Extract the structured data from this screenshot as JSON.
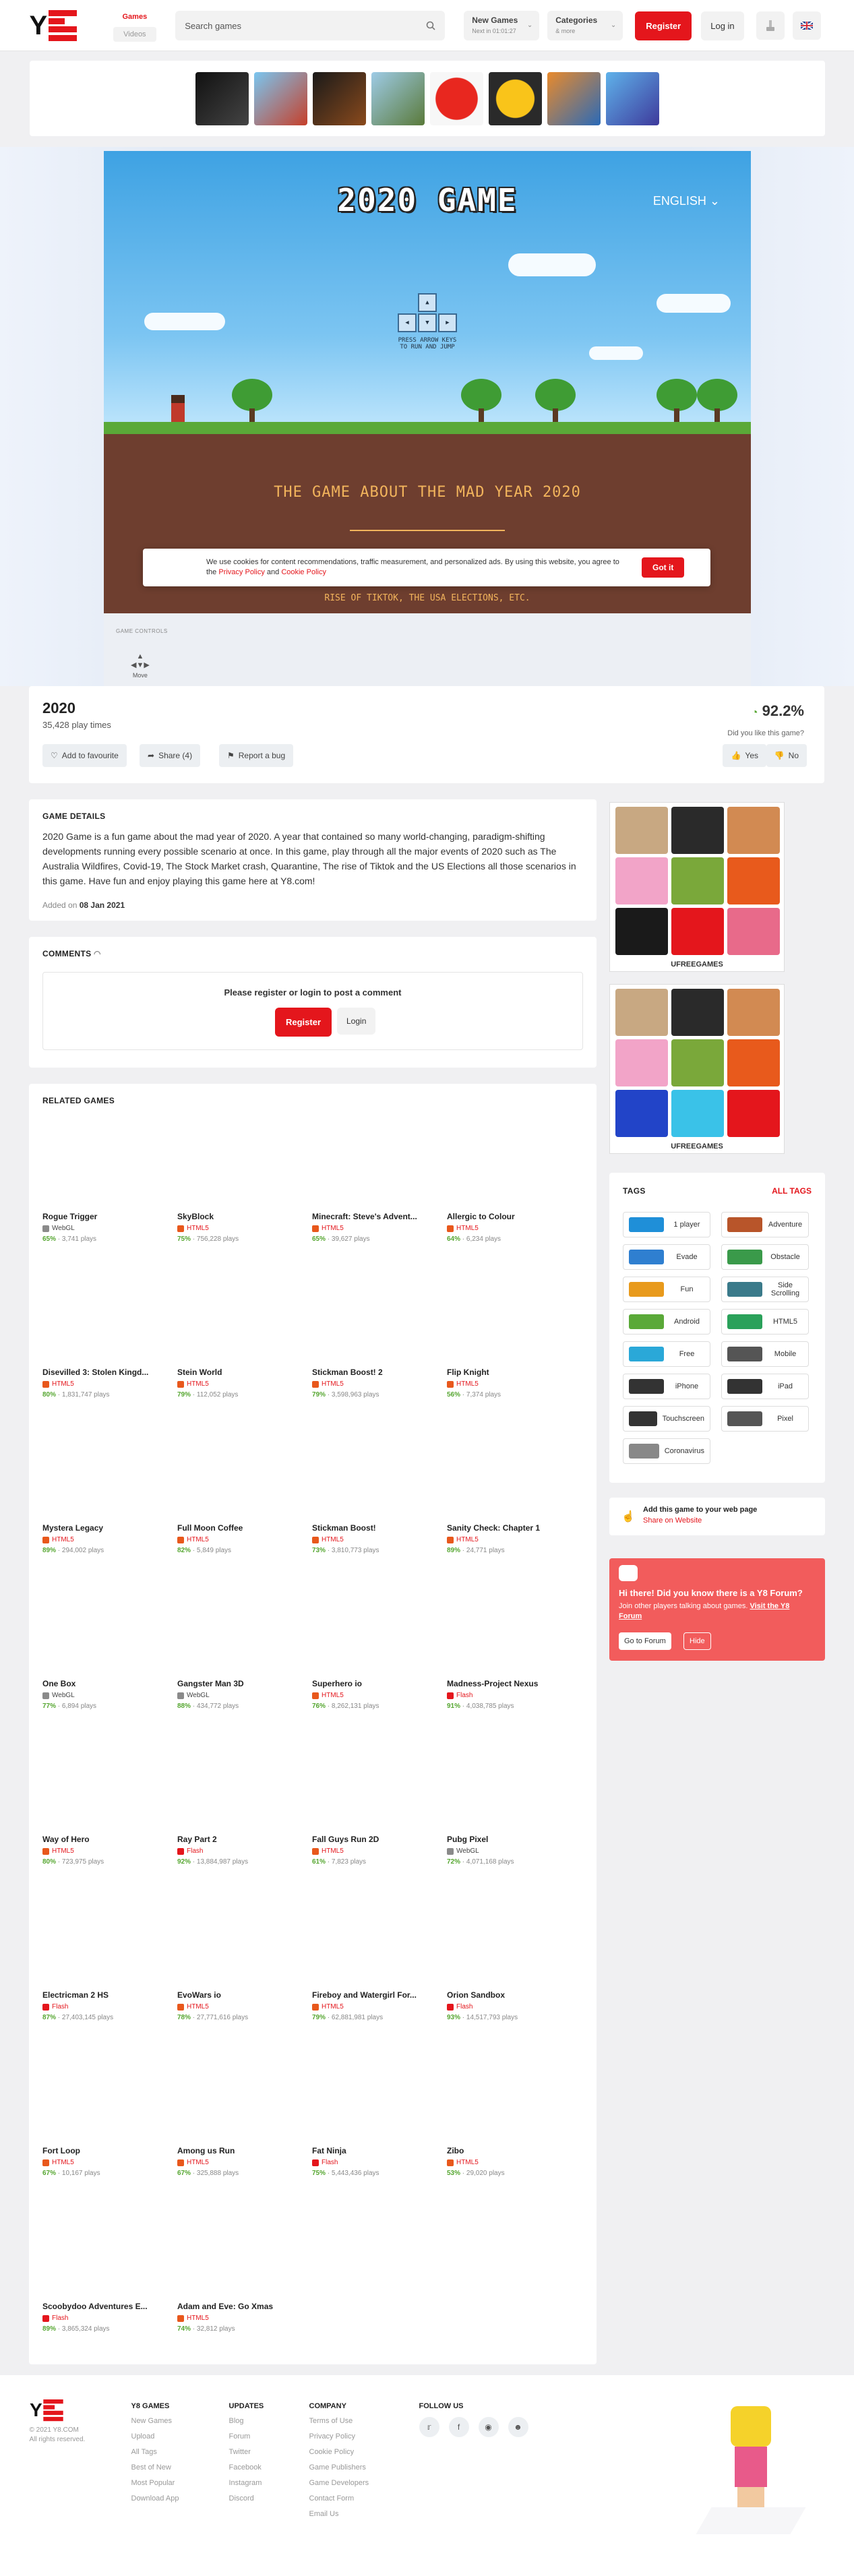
{
  "header": {
    "tabs": [
      "Games",
      "Videos"
    ],
    "search_placeholder": "Search games",
    "new_games": {
      "label": "New Games",
      "sub": "Next in 01:01:27"
    },
    "categories": {
      "label": "Categories",
      "sub": "& more"
    },
    "register": "Register",
    "login": "Log in"
  },
  "game": {
    "title_art": "2020 GAME",
    "language": "ENGLISH",
    "keys_hint": "PRESS ARROW KEYS TO RUN AND JUMP",
    "subtitle": "THE GAME ABOUT THE MAD YEAR 2020",
    "rise_text": "RISE OF TIKTOK, THE USA ELECTIONS, ETC.",
    "controls_label": "GAME CONTROLS",
    "controls_move": "Move"
  },
  "cookie": {
    "text": "We use cookies for content recommendations, traffic measurement, and personalized ads. By using this website, you agree to the",
    "privacy": "Privacy Policy",
    "and": "and",
    "cookie_policy": "Cookie Policy",
    "button": "Got it"
  },
  "info": {
    "title": "2020",
    "plays": "35,428 play times",
    "favourite": "Add to favourite",
    "share": "Share (4)",
    "report": "Report a bug",
    "rating": "92.2%",
    "like_question": "Did you like this game?",
    "yes": "Yes",
    "no": "No"
  },
  "details": {
    "heading": "GAME DETAILS",
    "description": "2020 Game is a fun game about the mad year of 2020. A year that contained so many world-changing, paradigm-shifting developments running every possible scenario at once. In this game, play through all the major events of 2020 such as The Australia Wildfires, Covid-19, The Stock Market crash, Quarantine, The rise of Tiktok and the US Elections all those scenarios in this game. Have fun and enjoy playing this game here at Y8.com!",
    "added_label": "Added on",
    "added_date": "08 Jan 2021"
  },
  "comments": {
    "heading": "COMMENTS",
    "prompt": "Please register or login to post a comment",
    "register": "Register",
    "login": "Login"
  },
  "related": {
    "heading": "RELATED GAMES",
    "games": [
      {
        "name": "Rogue Trigger",
        "tech": "WebGL",
        "rating": "65%",
        "plays": "3,741 plays"
      },
      {
        "name": "SkyBlock",
        "tech": "HTML5",
        "rating": "75%",
        "plays": "756,228 plays"
      },
      {
        "name": "Minecraft: Steve's Advent...",
        "tech": "HTML5",
        "rating": "65%",
        "plays": "39,627 plays"
      },
      {
        "name": "Allergic to Colour",
        "tech": "HTML5",
        "rating": "64%",
        "plays": "6,234 plays"
      },
      {
        "name": "Disevilled 3: Stolen Kingd...",
        "tech": "HTML5",
        "rating": "80%",
        "plays": "1,831,747 plays"
      },
      {
        "name": "Stein World",
        "tech": "HTML5",
        "rating": "79%",
        "plays": "112,052 plays"
      },
      {
        "name": "Stickman Boost! 2",
        "tech": "HTML5",
        "rating": "79%",
        "plays": "3,598,963 plays"
      },
      {
        "name": "Flip Knight",
        "tech": "HTML5",
        "rating": "56%",
        "plays": "7,374 plays"
      },
      {
        "name": "Mystera Legacy",
        "tech": "HTML5",
        "rating": "89%",
        "plays": "294,002 plays"
      },
      {
        "name": "Full Moon Coffee",
        "tech": "HTML5",
        "rating": "82%",
        "plays": "5,849 plays"
      },
      {
        "name": "Stickman Boost!",
        "tech": "HTML5",
        "rating": "73%",
        "plays": "3,810,773 plays"
      },
      {
        "name": "Sanity Check: Chapter 1",
        "tech": "HTML5",
        "rating": "89%",
        "plays": "24,771 plays"
      },
      {
        "name": "One Box",
        "tech": "WebGL",
        "rating": "77%",
        "plays": "6,894 plays"
      },
      {
        "name": "Gangster Man 3D",
        "tech": "WebGL",
        "rating": "88%",
        "plays": "434,772 plays"
      },
      {
        "name": "Superhero io",
        "tech": "HTML5",
        "rating": "76%",
        "plays": "8,262,131 plays"
      },
      {
        "name": "Madness-Project Nexus",
        "tech": "Flash",
        "rating": "91%",
        "plays": "4,038,785 plays"
      },
      {
        "name": "Way of Hero",
        "tech": "HTML5",
        "rating": "80%",
        "plays": "723,975 plays"
      },
      {
        "name": "Ray Part 2",
        "tech": "Flash",
        "rating": "92%",
        "plays": "13,884,987 plays"
      },
      {
        "name": "Fall Guys Run 2D",
        "tech": "HTML5",
        "rating": "61%",
        "plays": "7,823 plays"
      },
      {
        "name": "Pubg Pixel",
        "tech": "WebGL",
        "rating": "72%",
        "plays": "4,071,168 plays"
      },
      {
        "name": "Electricman 2 HS",
        "tech": "Flash",
        "rating": "87%",
        "plays": "27,403,145 plays"
      },
      {
        "name": "EvoWars io",
        "tech": "HTML5",
        "rating": "78%",
        "plays": "27,771,616 plays"
      },
      {
        "name": "Fireboy and Watergirl For...",
        "tech": "HTML5",
        "rating": "79%",
        "plays": "62,881,981 plays"
      },
      {
        "name": "Orion Sandbox",
        "tech": "Flash",
        "rating": "93%",
        "plays": "14,517,793 plays"
      },
      {
        "name": "Fort Loop",
        "tech": "HTML5",
        "rating": "67%",
        "plays": "10,167 plays"
      },
      {
        "name": "Among us Run",
        "tech": "HTML5",
        "rating": "67%",
        "plays": "325,888 plays"
      },
      {
        "name": "Fat Ninja",
        "tech": "Flash",
        "rating": "75%",
        "plays": "5,443,436 plays"
      },
      {
        "name": "Zibo",
        "tech": "HTML5",
        "rating": "53%",
        "plays": "29,020 plays"
      },
      {
        "name": "Scoobydoo Adventures E...",
        "tech": "Flash",
        "rating": "89%",
        "plays": "3,865,324 plays"
      },
      {
        "name": "Adam and Eve: Go Xmas",
        "tech": "HTML5",
        "rating": "74%",
        "plays": "32,812 plays"
      }
    ]
  },
  "ads": {
    "label": "UFREEGAMES"
  },
  "tags": {
    "heading": "TAGS",
    "all": "ALL TAGS",
    "items": [
      "1 player",
      "Adventure",
      "Evade",
      "Obstacle",
      "Fun",
      "Side Scrolling",
      "Android",
      "HTML5",
      "Free",
      "Mobile",
      "iPhone",
      "iPad",
      "Touchscreen",
      "Pixel",
      "Coronavirus"
    ]
  },
  "addsite": {
    "title": "Add this game to your web page",
    "link": "Share on Website"
  },
  "forum": {
    "question": "Hi there! Did you know there is a Y8 Forum?",
    "text": "Join other players talking about games.",
    "link": "Visit the Y8 Forum",
    "go": "Go to Forum",
    "hide": "Hide"
  },
  "footer": {
    "copyright": "© 2021 Y8.COM",
    "rights": "All rights reserved.",
    "y8games": {
      "heading": "Y8 GAMES",
      "links": [
        "New Games",
        "Upload",
        "All Tags",
        "Best of New",
        "Most Popular",
        "Download App"
      ]
    },
    "updates": {
      "heading": "UPDATES",
      "links": [
        "Blog",
        "Forum",
        "Twitter",
        "Facebook",
        "Instagram",
        "Discord"
      ]
    },
    "company": {
      "heading": "COMPANY",
      "links": [
        "Terms of Use",
        "Privacy Policy",
        "Cookie Policy",
        "Game Publishers",
        "Game Developers",
        "Contact Form",
        "Email Us"
      ]
    },
    "follow": {
      "heading": "FOLLOW US"
    }
  },
  "colors": {
    "brand_red": "#e4161c",
    "forum_bg": "#f25c5c",
    "rating_green": "#55a630"
  }
}
